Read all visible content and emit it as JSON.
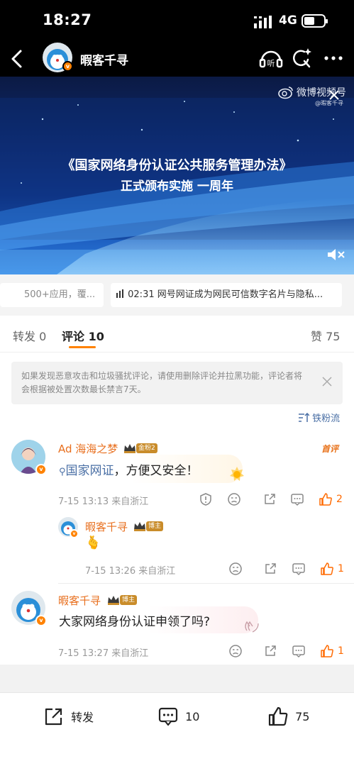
{
  "status_bar": {
    "time": "18:27",
    "network": "4G"
  },
  "nav": {
    "username": "暇客千寻",
    "verified_badge": "v",
    "icons": [
      "back-icon",
      "listen-icon",
      "share-spark-icon",
      "more-icon"
    ],
    "listen_label": "听"
  },
  "video": {
    "title_line1": "《国家网络身份认证公共服务管理办法》",
    "title_line2": "正式颁布实施 一周年",
    "watermark": "微博视频号",
    "watermark_sub": "@暇客千寻"
  },
  "chips": [
    {
      "label": "500+应用，覆..."
    },
    {
      "time": "02:31",
      "label": "网号网证成为网民可信数字名片与隐私..."
    }
  ],
  "tabs": {
    "repost_label": "转发",
    "repost_count": "0",
    "comment_label": "评论",
    "comment_count": "10",
    "like_label": "赞",
    "like_count": "75"
  },
  "notice": {
    "text": "如果发现恶意攻击和垃圾骚扰评论，请使用删除评论并拉黑功能，评论者将会根据被处置次数最长禁言7天。"
  },
  "sort_label": "铁粉流",
  "comments": [
    {
      "author": "Ad 海海之梦",
      "badge": "金粉2",
      "first_tag": "首评",
      "search_link": "国家网证",
      "text_rest": "，方便又安全！",
      "meta": "7-15 13:13  来自浙江",
      "likes": "2",
      "reply": {
        "author": "暇客千寻",
        "badge": "博主",
        "emoji": "🫰",
        "meta": "7-15 13:26  来自浙江",
        "likes": "1"
      }
    },
    {
      "author": "暇客千寻",
      "badge": "博主",
      "text": "大家网络身份认证申领了吗?",
      "meta": "7-15 13:27  来自浙江",
      "likes": "1"
    }
  ],
  "bottom_bar": {
    "repost_label": "转发",
    "comment_count": "10",
    "like_count": "75"
  },
  "colors": {
    "accent": "#ff8200",
    "name": "#e86f1e",
    "like": "#ff6a00",
    "link": "#4a6fa5"
  }
}
